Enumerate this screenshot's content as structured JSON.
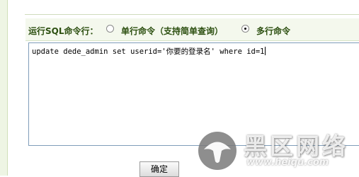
{
  "sql_command": {
    "label": "运行SQL命令行：",
    "options": [
      {
        "label": "单行命令（支持简单查询）",
        "selected": false
      },
      {
        "label": "多行命令",
        "selected": true
      }
    ],
    "query": "update dede_admin set userid='你要的登录名' where id=1"
  },
  "actions": {
    "confirm_label": "确定"
  },
  "watermark": {
    "title": "黑区网络",
    "url": "www.heiqu.com"
  }
}
